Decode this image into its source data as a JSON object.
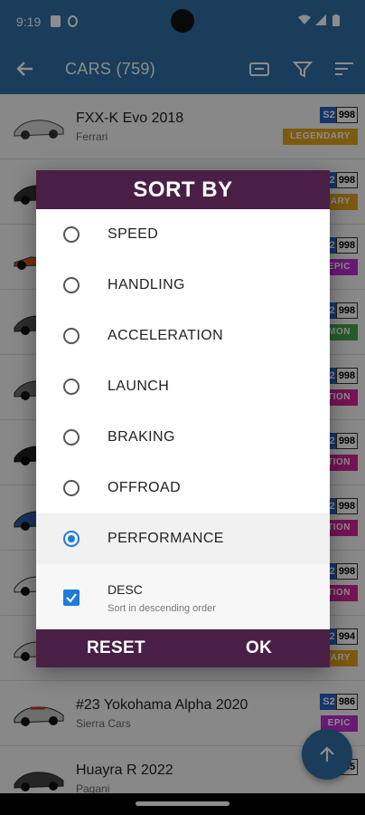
{
  "status_bar": {
    "time": "9:19"
  },
  "app_bar": {
    "title": "CARS (759)",
    "back_icon": "arrow-left-icon",
    "icons": [
      "ticket-icon",
      "filter-icon",
      "sort-icon"
    ]
  },
  "cars": [
    {
      "name": "FXX-K Evo",
      "year": "2018",
      "make": "Ferrari",
      "class": "S2",
      "pi": "998",
      "rarity": "LEGENDARY",
      "rarity_color": "#e3a51e"
    },
    {
      "name": "",
      "year": "",
      "make": "",
      "class": "S2",
      "pi": "998",
      "rarity": "LEGENDARY",
      "rarity_color": "#e3a51e"
    },
    {
      "name": "",
      "year": "",
      "make": "",
      "class": "S2",
      "pi": "998",
      "rarity": "EPIC",
      "rarity_color": "#c02fd6"
    },
    {
      "name": "",
      "year": "",
      "make": "",
      "class": "S2",
      "pi": "998",
      "rarity": "COMMON",
      "rarity_color": "#46a84f"
    },
    {
      "name": "",
      "year": "",
      "make": "",
      "class": "S2",
      "pi": "998",
      "rarity": "FORZA EDITION",
      "rarity_color": "#d8239a"
    },
    {
      "name": "",
      "year": "",
      "make": "",
      "class": "S2",
      "pi": "998",
      "rarity": "FORZA EDITION",
      "rarity_color": "#d8239a"
    },
    {
      "name": "",
      "year": "",
      "make": "",
      "class": "S2",
      "pi": "998",
      "rarity": "FORZA EDITION",
      "rarity_color": "#d8239a"
    },
    {
      "name": "",
      "year": "",
      "make": "",
      "class": "S2",
      "pi": "998",
      "rarity": "FORZA EDITION",
      "rarity_color": "#d8239a"
    },
    {
      "name": "",
      "year": "",
      "make": "",
      "class": "S2",
      "pi": "994",
      "rarity": "LEGENDARY",
      "rarity_color": "#e3a51e"
    },
    {
      "name": "#23 Yokohama Alpha",
      "year": "2020",
      "make": "Sierra Cars",
      "class": "S2",
      "pi": "986",
      "rarity": "EPIC",
      "rarity_color": "#c02fd6"
    },
    {
      "name": "Huayra R",
      "year": "2022",
      "make": "Pagani",
      "class": "S2",
      "pi": "985",
      "rarity": "",
      "rarity_color": "#e3a51e"
    }
  ],
  "dialog": {
    "title": "SORT BY",
    "options": [
      {
        "label": "SPEED",
        "selected": false
      },
      {
        "label": "HANDLING",
        "selected": false
      },
      {
        "label": "ACCELERATION",
        "selected": false
      },
      {
        "label": "LAUNCH",
        "selected": false
      },
      {
        "label": "BRAKING",
        "selected": false
      },
      {
        "label": "OFFROAD",
        "selected": false
      },
      {
        "label": "PERFORMANCE",
        "selected": true
      }
    ],
    "desc": {
      "label": "DESC",
      "hint": "Sort in descending order",
      "checked": true
    },
    "reset_label": "RESET",
    "ok_label": "OK"
  },
  "colors": {
    "primary": "#2f6fa6",
    "dialog_header": "#4a1f46",
    "accent": "#1f7bd6"
  }
}
